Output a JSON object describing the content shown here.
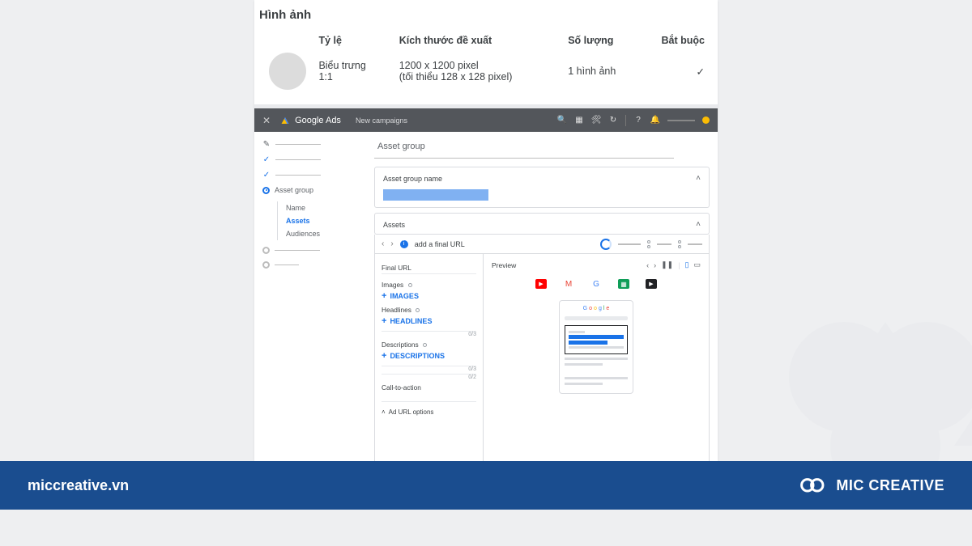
{
  "image_section": {
    "title": "Hình ảnh",
    "headers": {
      "ratio": "Tỷ lệ",
      "recommended": "Kích thước đề xuất",
      "quantity": "Số lượng",
      "required": "Bắt buộc"
    },
    "rows": [
      {
        "ratio_line1": "Biểu trưng",
        "ratio_line2": "1:1",
        "recommended_line1": "1200 x 1200 pixel",
        "recommended_line2": "(tối thiểu 128 x 128 pixel)",
        "quantity": "1 hình ảnh",
        "required": "✓"
      }
    ]
  },
  "ads": {
    "brand": "Google Ads",
    "subtitle": "New campaigns",
    "sidebar": {
      "asset_group_label": "Asset group",
      "sub": {
        "name": "Name",
        "assets": "Assets",
        "audiences": "Audiences"
      }
    },
    "main": {
      "title": "Asset group",
      "asset_group_name_label": "Asset group name",
      "assets_label": "Assets",
      "banner_text": "add a final URL",
      "left": {
        "final_url": "Final URL",
        "images_label": "Images",
        "images_add": "IMAGES",
        "headlines_label": "Headlines",
        "headlines_add": "HEADLINES",
        "descriptions_label": "Descriptions",
        "descriptions_add": "DESCRIPTIONS",
        "cta_label": "Call-to-action",
        "ad_url_options": "Ad URL options",
        "counters": {
          "c1": "0/3",
          "c2": "0/3",
          "c3": "0/2"
        }
      },
      "preview": {
        "label": "Preview",
        "google": "Google"
      }
    }
  },
  "footer": {
    "url": "miccreative.vn",
    "brand": "MIC CREATIVE"
  }
}
